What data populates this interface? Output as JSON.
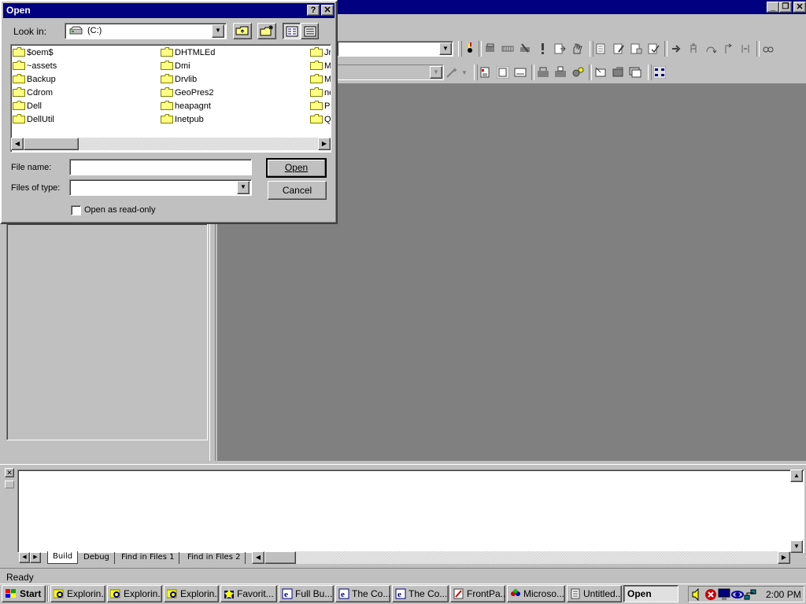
{
  "main_window": {
    "min_label": "_",
    "restore_label": "❐",
    "close_label": "✕"
  },
  "dialog": {
    "title": "Open",
    "help_label": "?",
    "close_label": "✕",
    "look_in_label": "Look in:",
    "look_in_value": "(C:)",
    "files": [
      {
        "name": "$oem$"
      },
      {
        "name": "~assets"
      },
      {
        "name": "Backup"
      },
      {
        "name": "Cdrom"
      },
      {
        "name": "Dell"
      },
      {
        "name": "DellUtil"
      },
      {
        "name": "DHTMLEd"
      },
      {
        "name": "Dmi"
      },
      {
        "name": "Drvlib"
      },
      {
        "name": "GeoPres2"
      },
      {
        "name": "heapagnt"
      },
      {
        "name": "Inetpub"
      },
      {
        "name": "Jr"
      },
      {
        "name": "M"
      },
      {
        "name": "M"
      },
      {
        "name": "ne"
      },
      {
        "name": "P"
      },
      {
        "name": "Q"
      }
    ],
    "file_name_label": "File name:",
    "file_name_value": "",
    "files_of_type_label": "Files of type:",
    "files_of_type_value": "",
    "open_label": "Open",
    "cancel_label": "Cancel",
    "readonly_label": "Open as read-only"
  },
  "output": {
    "tabs": [
      {
        "label": "Build"
      },
      {
        "label": "Debug"
      },
      {
        "label": "Find in Files 1"
      },
      {
        "label": "Find in Files 2"
      }
    ]
  },
  "status": {
    "text": "Ready"
  },
  "taskbar": {
    "start_label": "Start",
    "buttons": [
      {
        "label": "Explorin..."
      },
      {
        "label": "Explorin..."
      },
      {
        "label": "Explorin..."
      },
      {
        "label": "Favorit..."
      },
      {
        "label": "Full Bu..."
      },
      {
        "label": "The Co..."
      },
      {
        "label": "The Co..."
      },
      {
        "label": "FrontPa..."
      },
      {
        "label": "Microso..."
      },
      {
        "label": "Untitled..."
      },
      {
        "label": "Open"
      }
    ],
    "clock": "2:00 PM"
  },
  "colors": {
    "titlebar": "#000080",
    "face": "#c0c0c0",
    "workspace": "#808080",
    "folder": "#ffff80"
  }
}
